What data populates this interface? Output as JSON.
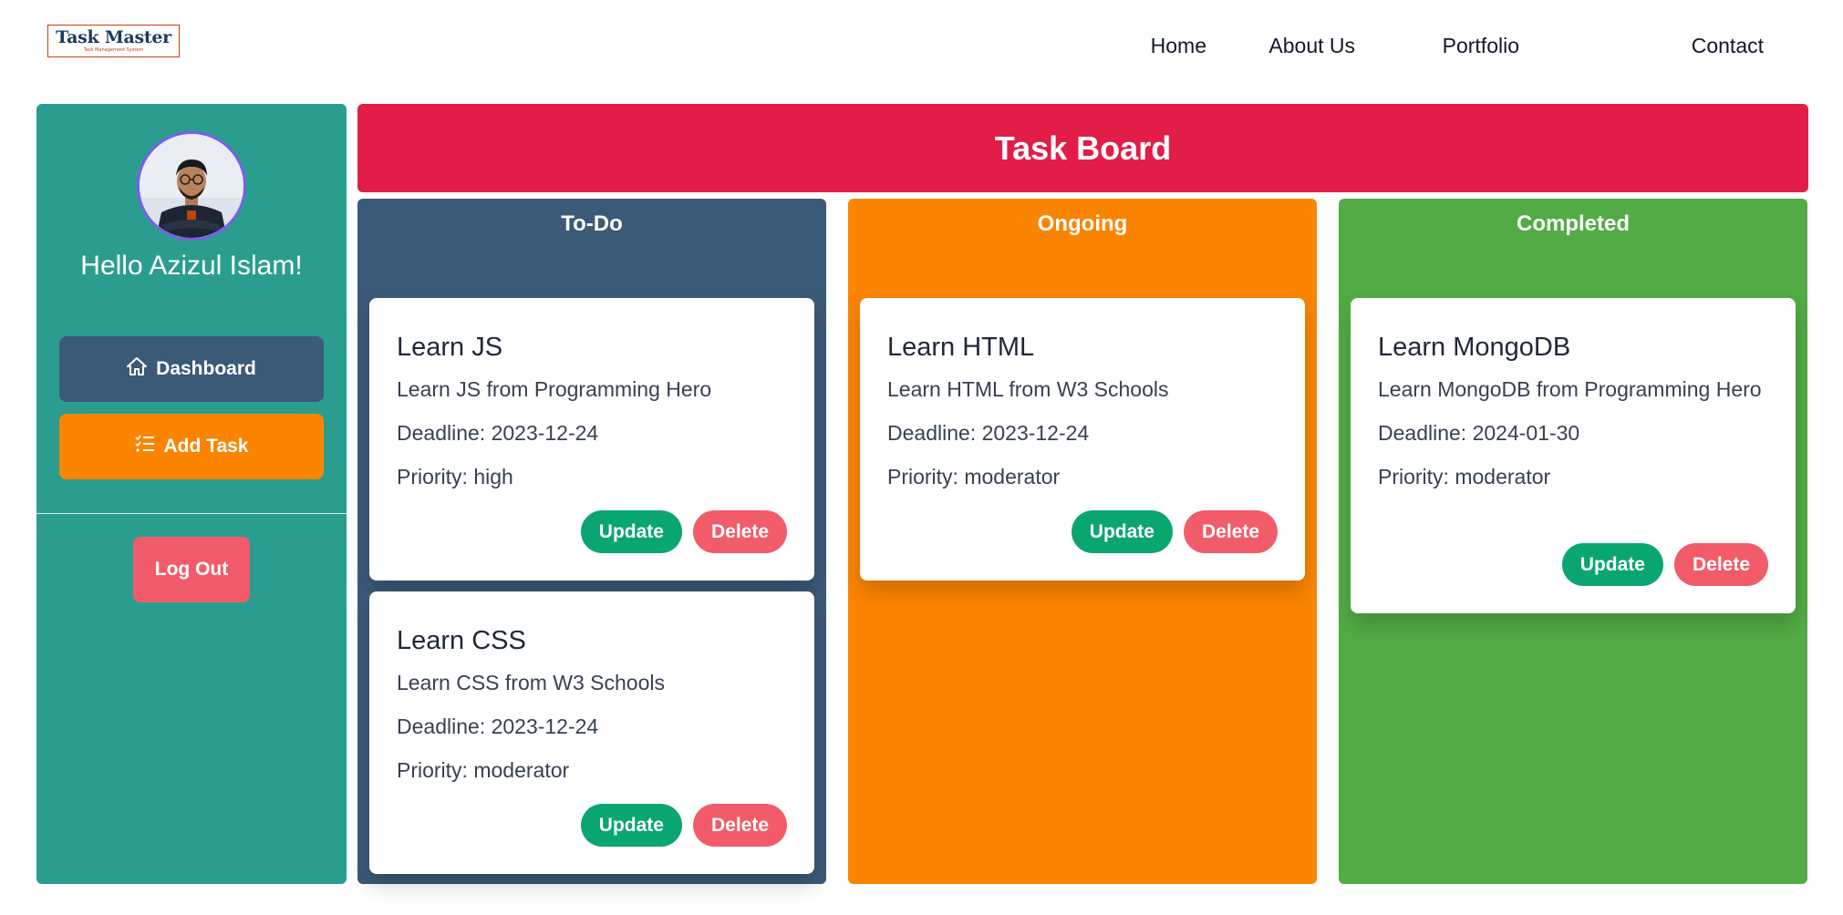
{
  "nav": {
    "logo_title": "Task Master",
    "logo_subtitle": "Task Management System",
    "links": [
      "Home",
      "About Us",
      "Portfolio",
      "Contact"
    ]
  },
  "sidebar": {
    "greeting": "Hello Azizul Islam!",
    "dashboard_label": "Dashboard",
    "add_task_label": "Add Task",
    "logout_label": "Log Out"
  },
  "board": {
    "title": "Task Board",
    "columns": [
      {
        "title": "To-Do",
        "tasks": [
          {
            "title": "Learn JS",
            "description": "Learn JS from Programming Hero",
            "deadline": "Deadline: 2023-12-24",
            "priority": "Priority: high"
          },
          {
            "title": "Learn CSS",
            "description": "Learn CSS from W3 Schools",
            "deadline": "Deadline: 2023-12-24",
            "priority": "Priority: moderator"
          }
        ]
      },
      {
        "title": "Ongoing",
        "tasks": [
          {
            "title": "Learn HTML",
            "description": "Learn HTML from W3 Schools",
            "deadline": "Deadline: 2023-12-24",
            "priority": "Priority: moderator"
          }
        ]
      },
      {
        "title": "Completed",
        "tasks": [
          {
            "title": "Learn MongoDB",
            "description": "Learn MongoDB from Programming Hero",
            "deadline": "Deadline: 2024-01-30",
            "priority": "Priority: moderator"
          }
        ]
      }
    ],
    "update_label": "Update",
    "delete_label": "Delete"
  },
  "colors": {
    "sidebar": "#2a9d8f",
    "header": "#e11d48",
    "todo": "#3b5a78",
    "ongoing": "#fb8500",
    "completed": "#52ab44",
    "update": "#0aa66f",
    "delete": "#f25c6a"
  },
  "icons": {
    "dashboard": "home-icon",
    "add_task": "list-check-icon"
  }
}
